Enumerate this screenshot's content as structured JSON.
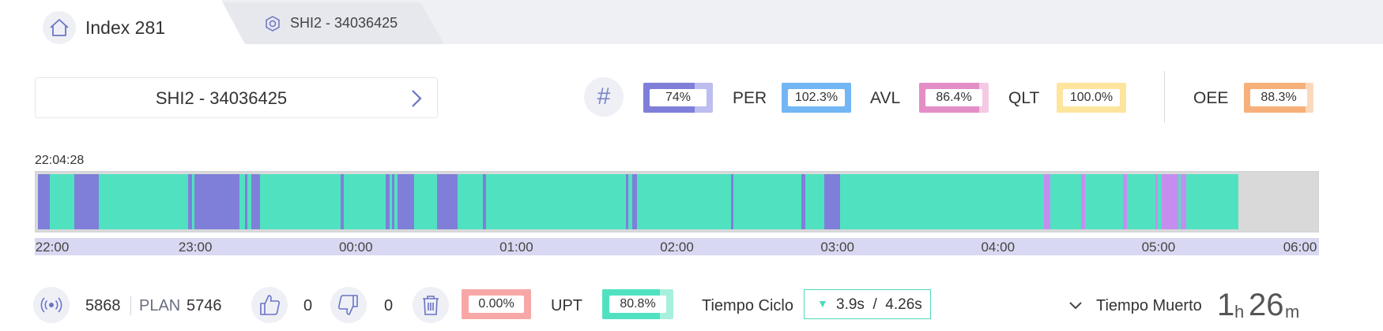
{
  "tabs": [
    {
      "label": "Index 281",
      "icon": "home-icon",
      "active": true
    },
    {
      "label": "SHI2 - 34036425",
      "icon": "hexagon-icon",
      "active": false
    }
  ],
  "selector": {
    "label": "SHI2 - 34036425",
    "icon": "chevron-right-icon"
  },
  "kpis": {
    "hash": {
      "symbol": "#",
      "value": "74%",
      "fill": 0.74,
      "color": "#7f7fd9",
      "bg": "#bdbdf0"
    },
    "per": {
      "label": "PER",
      "value": "102.3%",
      "fill": 1.0,
      "color": "#72b6f4",
      "bg": "#72b6f4"
    },
    "avl": {
      "label": "AVL",
      "value": "86.4%",
      "fill": 0.864,
      "color": "#e48ec7",
      "bg": "#f4c9e4"
    },
    "qlt": {
      "label": "QLT",
      "value": "100.0%",
      "fill": 1.0,
      "color": "#fde59e",
      "bg": "#fde59e"
    },
    "oee": {
      "label": "OEE",
      "value": "88.3%",
      "fill": 0.883,
      "color": "#f7b07a",
      "bg": "#fcd8bb"
    }
  },
  "timeline": {
    "start_time": "22:04:28",
    "ticks": [
      "22:00",
      "23:00",
      "00:00",
      "01:00",
      "02:00",
      "03:00",
      "04:00",
      "05:00",
      "06:00"
    ],
    "colors": {
      "run": "#50e2c0",
      "stop": "#7f7fd9",
      "other": "#c58df0",
      "empty": "#d9d9d9"
    },
    "segments": [
      {
        "state": "stop",
        "start": 0.002,
        "end": 0.011
      },
      {
        "state": "run",
        "start": 0.011,
        "end": 0.03
      },
      {
        "state": "stop",
        "start": 0.03,
        "end": 0.049
      },
      {
        "state": "run",
        "start": 0.049,
        "end": 0.119
      },
      {
        "state": "stop",
        "start": 0.119,
        "end": 0.122
      },
      {
        "state": "run",
        "start": 0.122,
        "end": 0.124
      },
      {
        "state": "stop",
        "start": 0.124,
        "end": 0.159
      },
      {
        "state": "run",
        "start": 0.159,
        "end": 0.163
      },
      {
        "state": "stop",
        "start": 0.163,
        "end": 0.165
      },
      {
        "state": "run",
        "start": 0.165,
        "end": 0.168
      },
      {
        "state": "stop",
        "start": 0.168,
        "end": 0.175
      },
      {
        "state": "run",
        "start": 0.175,
        "end": 0.238
      },
      {
        "state": "stop",
        "start": 0.238,
        "end": 0.24
      },
      {
        "state": "run",
        "start": 0.24,
        "end": 0.273
      },
      {
        "state": "stop",
        "start": 0.273,
        "end": 0.276
      },
      {
        "state": "run",
        "start": 0.276,
        "end": 0.278
      },
      {
        "state": "stop",
        "start": 0.278,
        "end": 0.28
      },
      {
        "state": "run",
        "start": 0.28,
        "end": 0.282
      },
      {
        "state": "stop",
        "start": 0.282,
        "end": 0.295
      },
      {
        "state": "run",
        "start": 0.295,
        "end": 0.313
      },
      {
        "state": "stop",
        "start": 0.313,
        "end": 0.329
      },
      {
        "state": "run",
        "start": 0.329,
        "end": 0.349
      },
      {
        "state": "stop",
        "start": 0.349,
        "end": 0.351
      },
      {
        "state": "run",
        "start": 0.351,
        "end": 0.46
      },
      {
        "state": "stop",
        "start": 0.46,
        "end": 0.462
      },
      {
        "state": "run",
        "start": 0.462,
        "end": 0.465
      },
      {
        "state": "stop",
        "start": 0.465,
        "end": 0.469
      },
      {
        "state": "run",
        "start": 0.469,
        "end": 0.542
      },
      {
        "state": "stop",
        "start": 0.542,
        "end": 0.544
      },
      {
        "state": "run",
        "start": 0.544,
        "end": 0.597
      },
      {
        "state": "stop",
        "start": 0.597,
        "end": 0.6
      },
      {
        "state": "run",
        "start": 0.6,
        "end": 0.615
      },
      {
        "state": "stop",
        "start": 0.615,
        "end": 0.627
      },
      {
        "state": "run",
        "start": 0.627,
        "end": 0.786
      },
      {
        "state": "other",
        "start": 0.786,
        "end": 0.791
      },
      {
        "state": "run",
        "start": 0.791,
        "end": 0.815
      },
      {
        "state": "other",
        "start": 0.815,
        "end": 0.818
      },
      {
        "state": "run",
        "start": 0.818,
        "end": 0.848
      },
      {
        "state": "other",
        "start": 0.848,
        "end": 0.851
      },
      {
        "state": "run",
        "start": 0.851,
        "end": 0.873
      },
      {
        "state": "other",
        "start": 0.873,
        "end": 0.875
      },
      {
        "state": "run",
        "start": 0.875,
        "end": 0.878
      },
      {
        "state": "other",
        "start": 0.878,
        "end": 0.891
      },
      {
        "state": "run",
        "start": 0.891,
        "end": 0.893
      },
      {
        "state": "other",
        "start": 0.893,
        "end": 0.897
      },
      {
        "state": "run",
        "start": 0.897,
        "end": 0.938
      }
    ]
  },
  "bottom": {
    "count": "5868",
    "plan_label": "PLAN",
    "plan_value": "5746",
    "thumbs_up": "0",
    "thumbs_down": "0",
    "scrap": {
      "value": "0.00%",
      "fill": 1.0,
      "color": "#f7a8a6",
      "bg": "#f7a8a6"
    },
    "upt": {
      "label": "UPT",
      "value": "80.8%",
      "fill": 0.808,
      "color": "#50e2c0",
      "bg": "#a8f0de"
    },
    "ciclo": {
      "label": "Tiempo Ciclo",
      "arrow": "▼",
      "value": "3.9s  /  4.26s"
    },
    "muerto": {
      "label": "Tiempo Muerto",
      "hours": "1",
      "h_unit": "h",
      "minutes": "26",
      "m_unit": "m"
    }
  }
}
